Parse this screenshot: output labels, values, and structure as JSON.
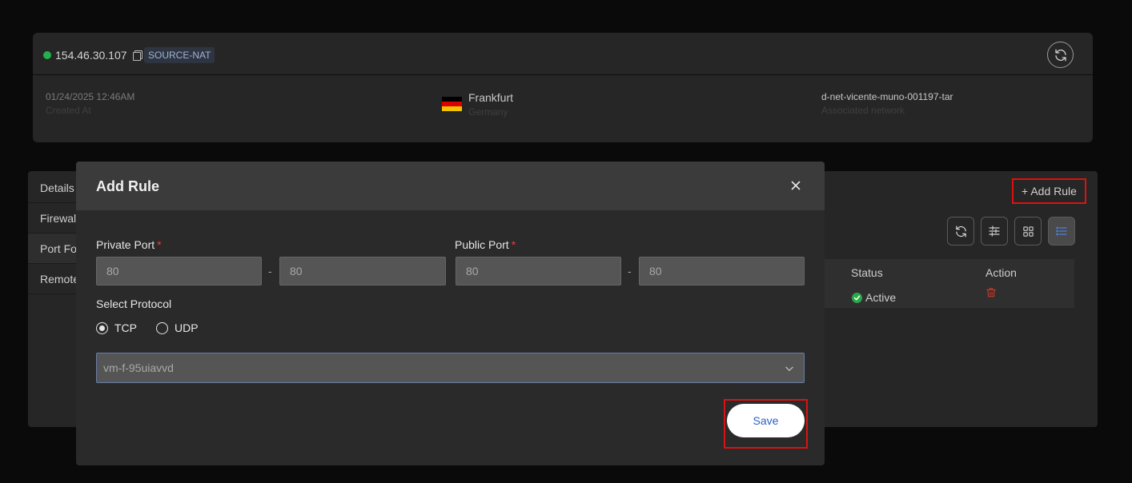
{
  "ip_card": {
    "ip": "154.46.30.107",
    "tag": "SOURCE-NAT",
    "created_value": "01/24/2025 12:46AM",
    "created_label": "Created At",
    "city": "Frankfurt",
    "country": "Germany",
    "network_value": "d-net-vicente-muno-001197-tar",
    "network_label": "Associated network"
  },
  "sidebar": {
    "items": [
      {
        "label": "Details"
      },
      {
        "label": "Firewall"
      },
      {
        "label": "Port Forwarding"
      },
      {
        "label": "Remote Access"
      }
    ]
  },
  "toolbar": {
    "add_rule_label": "+ Add Rule",
    "icons": [
      "refresh-icon",
      "sliders-icon",
      "grid-icon",
      "list-icon"
    ]
  },
  "table": {
    "headers": [
      "Status",
      "Action"
    ],
    "rows": [
      {
        "status": "Active"
      }
    ]
  },
  "modal": {
    "title": "Add Rule",
    "private_port_label": "Private Port",
    "public_port_label": "Public Port",
    "required_mark": "*",
    "private_port_from": "80",
    "private_port_to": "80",
    "public_port_from": "80",
    "public_port_to": "80",
    "separator": "-",
    "protocol_label": "Select Protocol",
    "protocols": [
      "TCP",
      "UDP"
    ],
    "selected_protocol": "TCP",
    "vm_select_value": "vm-f-95uiavvd",
    "save_label": "Save"
  },
  "colors": {
    "status_active": "#2aa84a",
    "highlight": "#dd1111",
    "delete_icon": "#c0392b",
    "save_text": "#2a5fc4"
  }
}
